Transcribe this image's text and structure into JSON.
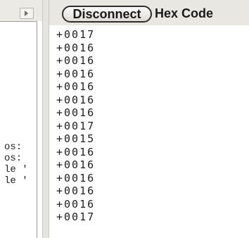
{
  "toolbar": {
    "disconnect_label": "Disconnect",
    "hex_code_label": "Hex Code"
  },
  "left_panel": {
    "fragments": [
      "os:",
      "os:",
      "le '",
      "le '"
    ]
  },
  "readings": [
    "+0017",
    "+0016",
    "+0016",
    "+0016",
    "+0016",
    "+0016",
    "+0016",
    "+0017",
    "+0015",
    "+0016",
    "+0016",
    "+0016",
    "+0016",
    "+0016",
    "+0017"
  ],
  "icons": {
    "scroll_right": "chevron-right-icon"
  }
}
